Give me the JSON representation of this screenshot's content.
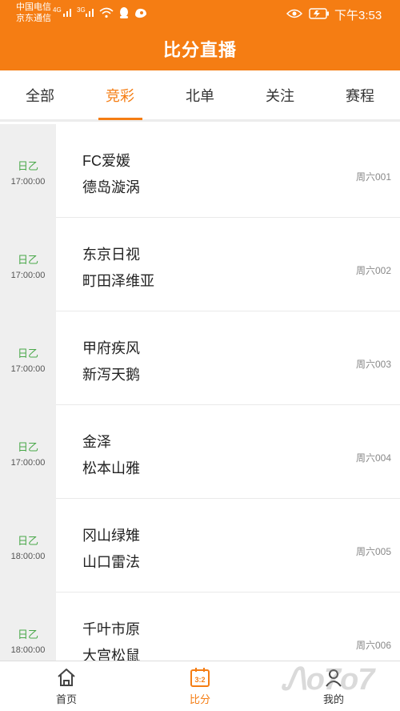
{
  "status": {
    "carrier1": "中国电信",
    "carrier2": "京东通信",
    "net1": "4G",
    "net2": "3G",
    "time": "下午3:53"
  },
  "header": {
    "title": "比分直播"
  },
  "tabs": [
    {
      "label": "全部"
    },
    {
      "label": "竞彩"
    },
    {
      "label": "北单"
    },
    {
      "label": "关注"
    },
    {
      "label": "赛程"
    }
  ],
  "active_tab": "竞彩",
  "matches": [
    {
      "league": "日乙",
      "time": "17:00:00",
      "home": "FC爱媛",
      "away": "德岛漩涡",
      "number": "周六001"
    },
    {
      "league": "日乙",
      "time": "17:00:00",
      "home": "东京日视",
      "away": "町田泽维亚",
      "number": "周六002"
    },
    {
      "league": "日乙",
      "time": "17:00:00",
      "home": "甲府疾风",
      "away": "新泻天鹅",
      "number": "周六003"
    },
    {
      "league": "日乙",
      "time": "17:00:00",
      "home": "金泽",
      "away": "松本山雅",
      "number": "周六004"
    },
    {
      "league": "日乙",
      "time": "18:00:00",
      "home": "冈山绿雉",
      "away": "山口雷法",
      "number": "周六005"
    },
    {
      "league": "日乙",
      "time": "18:00:00",
      "home": "千叶市原",
      "away": "大宫松鼠",
      "number": "周六006"
    }
  ],
  "bottom_nav": [
    {
      "label": "首页",
      "icon": "home-icon"
    },
    {
      "label": "比分",
      "icon": "score-icon",
      "icon_text": "3:2"
    },
    {
      "label": "我的",
      "icon": "user-icon"
    }
  ],
  "colors": {
    "accent": "#f57d13",
    "league": "#4aa84a"
  }
}
